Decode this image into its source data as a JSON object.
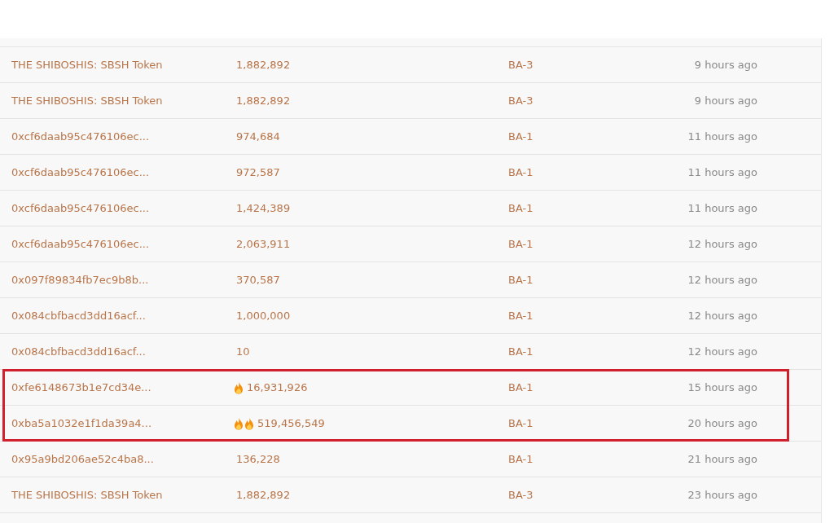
{
  "rows": [
    {
      "from": "THE SHIBOSHIS: SBSH Token",
      "kind": "plain",
      "amount": "1,882,892",
      "method": "BA-3",
      "age": "9 hours ago",
      "highlighted": false
    },
    {
      "from": "THE SHIBOSHIS: SBSH Token",
      "kind": "plain",
      "amount": "1,882,892",
      "method": "BA-3",
      "age": "9 hours ago",
      "highlighted": false
    },
    {
      "from": "0xcf6daab95c476106ec...",
      "kind": "plain",
      "amount": "974,684",
      "method": "BA-1",
      "age": "11 hours ago",
      "highlighted": false
    },
    {
      "from": "0xcf6daab95c476106ec...",
      "kind": "plain",
      "amount": "972,587",
      "method": "BA-1",
      "age": "11 hours ago",
      "highlighted": false
    },
    {
      "from": "0xcf6daab95c476106ec...",
      "kind": "plain",
      "amount": "1,424,389",
      "method": "BA-1",
      "age": "11 hours ago",
      "highlighted": false
    },
    {
      "from": "0xcf6daab95c476106ec...",
      "kind": "plain",
      "amount": "2,063,911",
      "method": "BA-1",
      "age": "12 hours ago",
      "highlighted": false
    },
    {
      "from": "0x097f89834fb7ec9b8b...",
      "kind": "plain",
      "amount": "370,587",
      "method": "BA-1",
      "age": "12 hours ago",
      "highlighted": false
    },
    {
      "from": "0x084cbfbacd3dd16acf...",
      "kind": "plain",
      "amount": "1,000,000",
      "method": "BA-1",
      "age": "12 hours ago",
      "highlighted": false
    },
    {
      "from": "0x084cbfbacd3dd16acf...",
      "kind": "plain",
      "amount": "10",
      "method": "BA-1",
      "age": "12 hours ago",
      "highlighted": false
    },
    {
      "from": "0xfe6148673b1e7cd34e...",
      "kind": "single-flame",
      "amount": "16,931,926",
      "method": "BA-1",
      "age": "15 hours ago",
      "highlighted": true
    },
    {
      "from": "0xba5a1032e1f1da39a4...",
      "kind": "double-flame",
      "amount": "519,456,549",
      "method": "BA-1",
      "age": "20 hours ago",
      "highlighted": true
    },
    {
      "from": "0x95a9bd206ae52c4ba8...",
      "kind": "plain",
      "amount": "136,228",
      "method": "BA-1",
      "age": "21 hours ago",
      "highlighted": false
    },
    {
      "from": "THE SHIBOSHIS: SBSH Token",
      "kind": "plain",
      "amount": "1,882,892",
      "method": "BA-3",
      "age": "23 hours ago",
      "highlighted": false
    }
  ]
}
